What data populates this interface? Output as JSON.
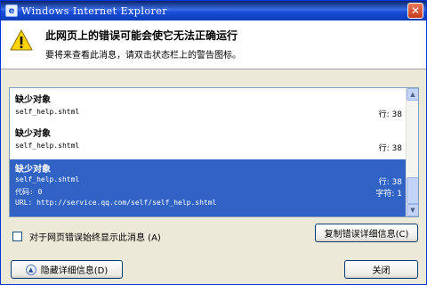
{
  "window": {
    "title": "Windows Internet Explorer",
    "close_glyph": "✕"
  },
  "header": {
    "title": "此网页上的错误可能会使它无法正确运行",
    "subtitle": "要将来查看此消息，请双击状态栏上的警告图标。"
  },
  "errors": [
    {
      "category": "缺少对象",
      "file": "self_help.shtml",
      "line": "行: 38"
    },
    {
      "category": "缺少对象",
      "file": "self_help.shtml",
      "line": "行: 38"
    },
    {
      "category": "缺少对象",
      "file": "self_help.shtml",
      "line": "行: 38",
      "code": "代码: 0",
      "char": "字符: 1",
      "url": "URL: http://service.qq.com/self/self_help.shtml"
    }
  ],
  "checkbox": {
    "label": "对于网页错误始终显示此消息 (A)",
    "checked": false
  },
  "buttons": {
    "copy": "复制错误详细信息(C)",
    "hide": "隐藏详细信息(D)",
    "close": "关闭"
  },
  "colors": {
    "selection": "#3163c5",
    "title_bar": "#1c4ed8"
  }
}
